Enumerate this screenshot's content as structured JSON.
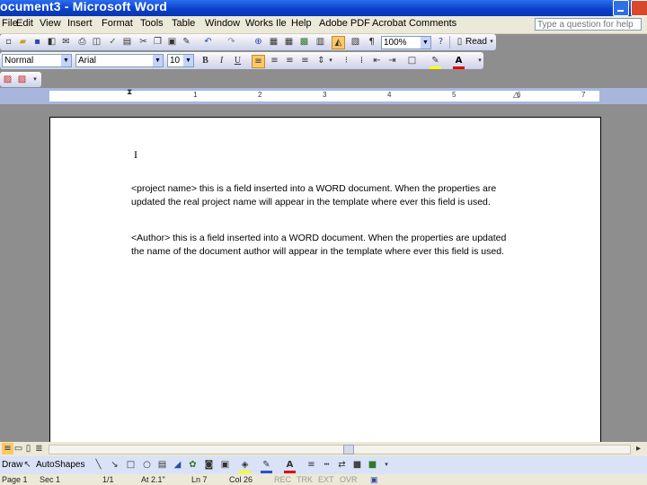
{
  "window": {
    "title": "ocument3 - Microsoft Word"
  },
  "menu": [
    "File",
    "Edit",
    "View",
    "Insert",
    "Format",
    "Tools",
    "Table",
    "Window",
    "Works Ile",
    "Help",
    "Adobe PDF",
    "Acrobat Comments"
  ],
  "help_box": {
    "placeholder": "Type a question for help"
  },
  "standard_toolbar": {
    "zoom": "100%",
    "read_label": "Read"
  },
  "formatting_toolbar": {
    "style": "Normal",
    "font": "Arial",
    "size": "10"
  },
  "ruler": {
    "numbers": [
      "1",
      "2",
      "3",
      "4",
      "5",
      "6",
      "7"
    ]
  },
  "document": {
    "cursor": "I",
    "paragraphs": [
      "<project name> this is a field inserted into a WORD document. When the properties are updated the real project name will appear in the template where ever this field is used.",
      "<Author> this is a field inserted into a WORD document. When the properties are updated the name of the document author will appear in the template where ever this field is used."
    ]
  },
  "drawing_toolbar": {
    "draw_label": "Draw",
    "autoshapes_label": "AutoShapes"
  },
  "status": {
    "page": "Page 1",
    "sec": "Sec 1",
    "pages": "1/1",
    "at": "At 2.1\"",
    "ln": "Ln 7",
    "col": "Col 26",
    "rec": "REC",
    "trk": "TRK",
    "ext": "EXT",
    "ovr": "OVR"
  },
  "colors": {
    "title_bar": "#0a3fc8",
    "page": "#ffffff",
    "workspace": "#8e8e8e",
    "toolbar": "#dde4f6"
  }
}
